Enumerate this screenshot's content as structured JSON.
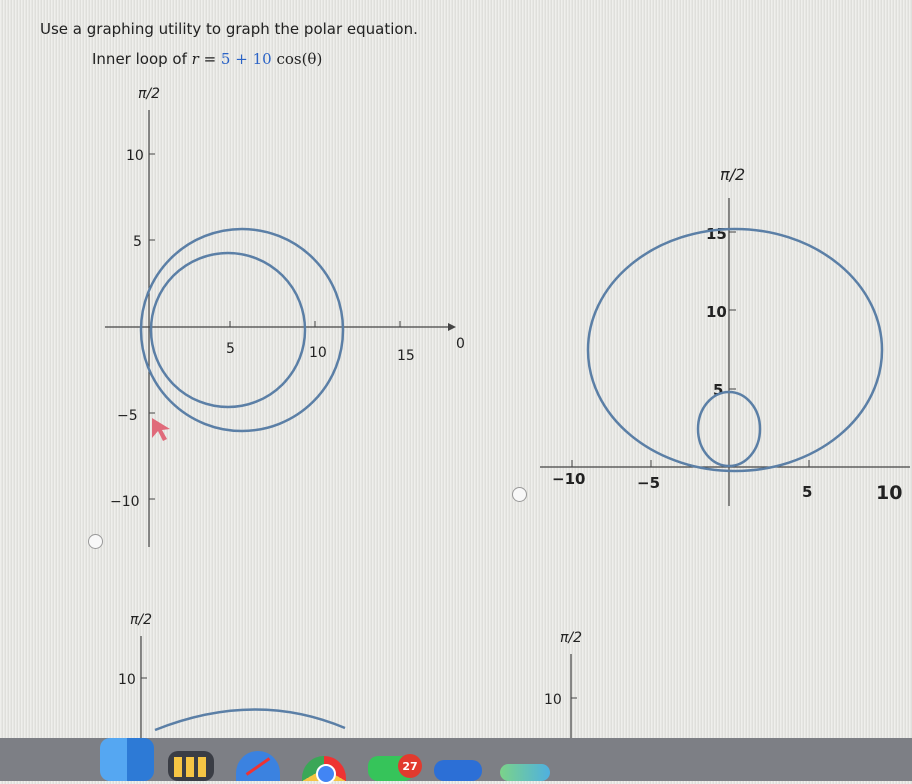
{
  "question": {
    "text": "Use a graphing utility to graph the polar equation."
  },
  "subquestion": {
    "prefix": "Inner loop of ",
    "var": "r",
    "equals": " = ",
    "c1": "5",
    "plus": " + ",
    "c2": "10",
    "fn": " cos(",
    "theta": "θ",
    "close": ")"
  },
  "options": [
    {
      "id": "a",
      "axis_top_label": "π/2",
      "axis_right_label": "0",
      "x_ticks": [
        "5",
        "10",
        "15"
      ],
      "y_ticks": [
        "10",
        "5",
        "−5",
        "−10"
      ]
    },
    {
      "id": "b",
      "axis_top_label": "π/2",
      "x_ticks": [
        "−10",
        "−5",
        "5",
        "10"
      ],
      "y_ticks": [
        "15",
        "10",
        "5"
      ]
    },
    {
      "id": "c",
      "axis_top_label": "π/2",
      "y_ticks": [
        "10"
      ]
    },
    {
      "id": "d",
      "axis_top_label": "π/2",
      "y_ticks": [
        "10"
      ]
    }
  ],
  "dock": {
    "badge_count": "27",
    "icons": [
      "finder-icon",
      "launchpad-icon",
      "safari-icon",
      "chrome-icon",
      "facetime-icon",
      "mail-icon",
      "app-icon"
    ]
  },
  "colors": {
    "curve": "#5b7fa6",
    "accent": "#2b63c6",
    "cursor": "#e06a7a"
  }
}
